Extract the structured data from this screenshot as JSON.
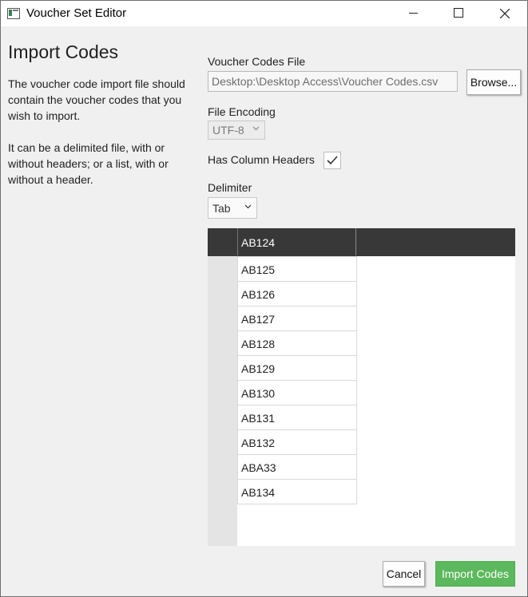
{
  "window": {
    "title": "Voucher Set Editor"
  },
  "sidebar": {
    "heading": "Import Codes",
    "paragraph1": "The voucher code import file should contain the voucher codes that you wish to import.",
    "paragraph2": "It can be a delimited file, with or without headers; or a list, with or without a header."
  },
  "form": {
    "file_label": "Voucher Codes File",
    "file_value": "Desktop:\\Desktop Access\\Voucher Codes.csv",
    "browse_label": "Browse...",
    "encoding_label": "File Encoding",
    "encoding_value": "UTF-8",
    "headers_label": "Has Column Headers",
    "headers_checked": true,
    "delimiter_label": "Delimiter",
    "delimiter_value": "Tab"
  },
  "grid": {
    "header": "AB124",
    "rows": [
      "AB125",
      "AB126",
      "AB127",
      "AB128",
      "AB129",
      "AB130",
      "AB131",
      "AB132",
      "ABA33",
      "AB134"
    ]
  },
  "footer": {
    "cancel_label": "Cancel",
    "import_label": "Import Codes"
  },
  "colors": {
    "primary_button": "#5cb85c",
    "grid_header": "#383838"
  }
}
